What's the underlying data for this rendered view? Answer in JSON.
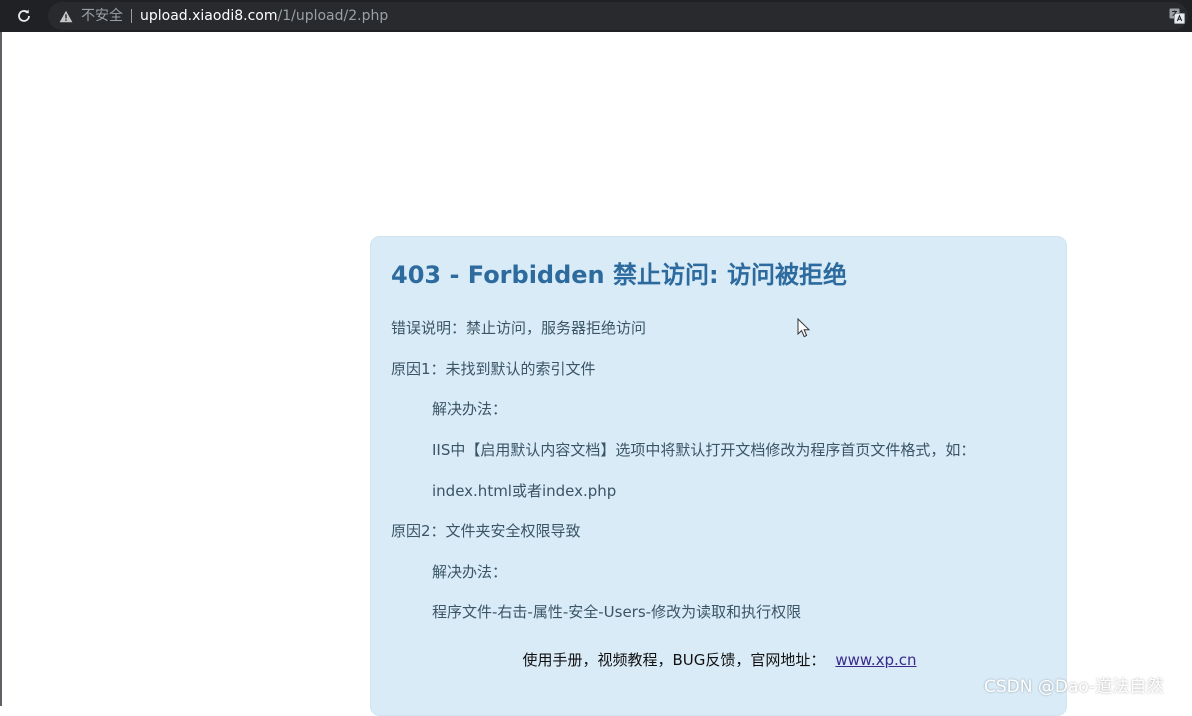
{
  "browser": {
    "security_label": "不安全",
    "url_host": "upload.xiaodi8.com",
    "url_path": "/1/upload/2.php",
    "icons": {
      "reload": "reload-icon",
      "warning": "warning-icon",
      "translate": "translate-icon"
    }
  },
  "error": {
    "title": "403 - Forbidden 禁止访问: 访问被拒绝",
    "lines": [
      "错误说明：禁止访问，服务器拒绝访问",
      "原因1：未找到默认的索引文件",
      "解决办法：",
      "IIS中【启用默认内容文档】选项中将默认打开文档修改为程序首页文件格式，如：",
      "index.html或者index.php",
      "原因2：文件夹安全权限导致",
      "解决办法：",
      "程序文件-右击-属性-安全-Users-修改为读取和执行权限"
    ],
    "footer_text": "使用手册，视频教程，BUG反馈，官网地址：",
    "footer_link": "www.xp.cn"
  },
  "watermark": "CSDN @Dao-道法自然",
  "colors": {
    "panel_bg": "#d9ebf7",
    "title": "#2d6b9e",
    "text": "#3a5566",
    "link": "#3b2a8c",
    "chrome_bg": "#202124"
  }
}
